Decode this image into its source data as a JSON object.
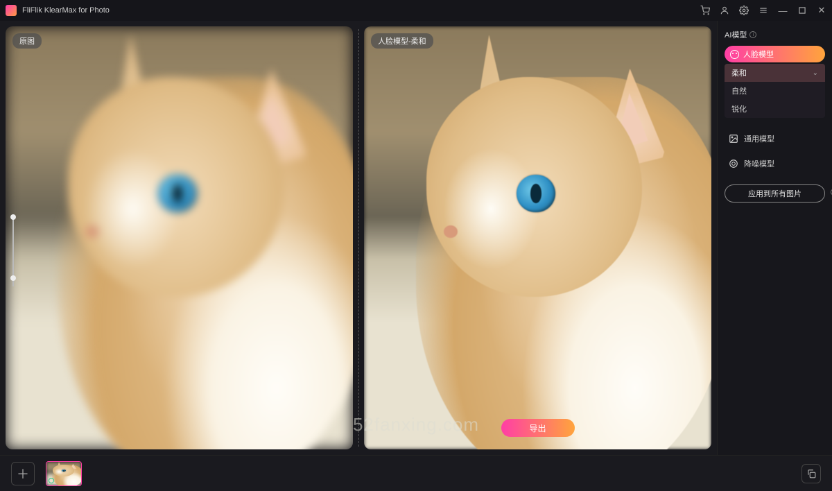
{
  "app": {
    "title": "FliFlik KlearMax for Photo"
  },
  "panes": {
    "left_label": "原图",
    "right_label": "人脸模型-柔和"
  },
  "export_label": "导出",
  "sidebar": {
    "title": "AI模型",
    "face_model": "人脸模型",
    "options": [
      "柔和",
      "自然",
      "锐化"
    ],
    "selected_option": "柔和",
    "general_model": "通用模型",
    "denoise_model": "降噪模型",
    "apply_all": "应用到所有图片"
  },
  "watermark": "52fanxing.com"
}
